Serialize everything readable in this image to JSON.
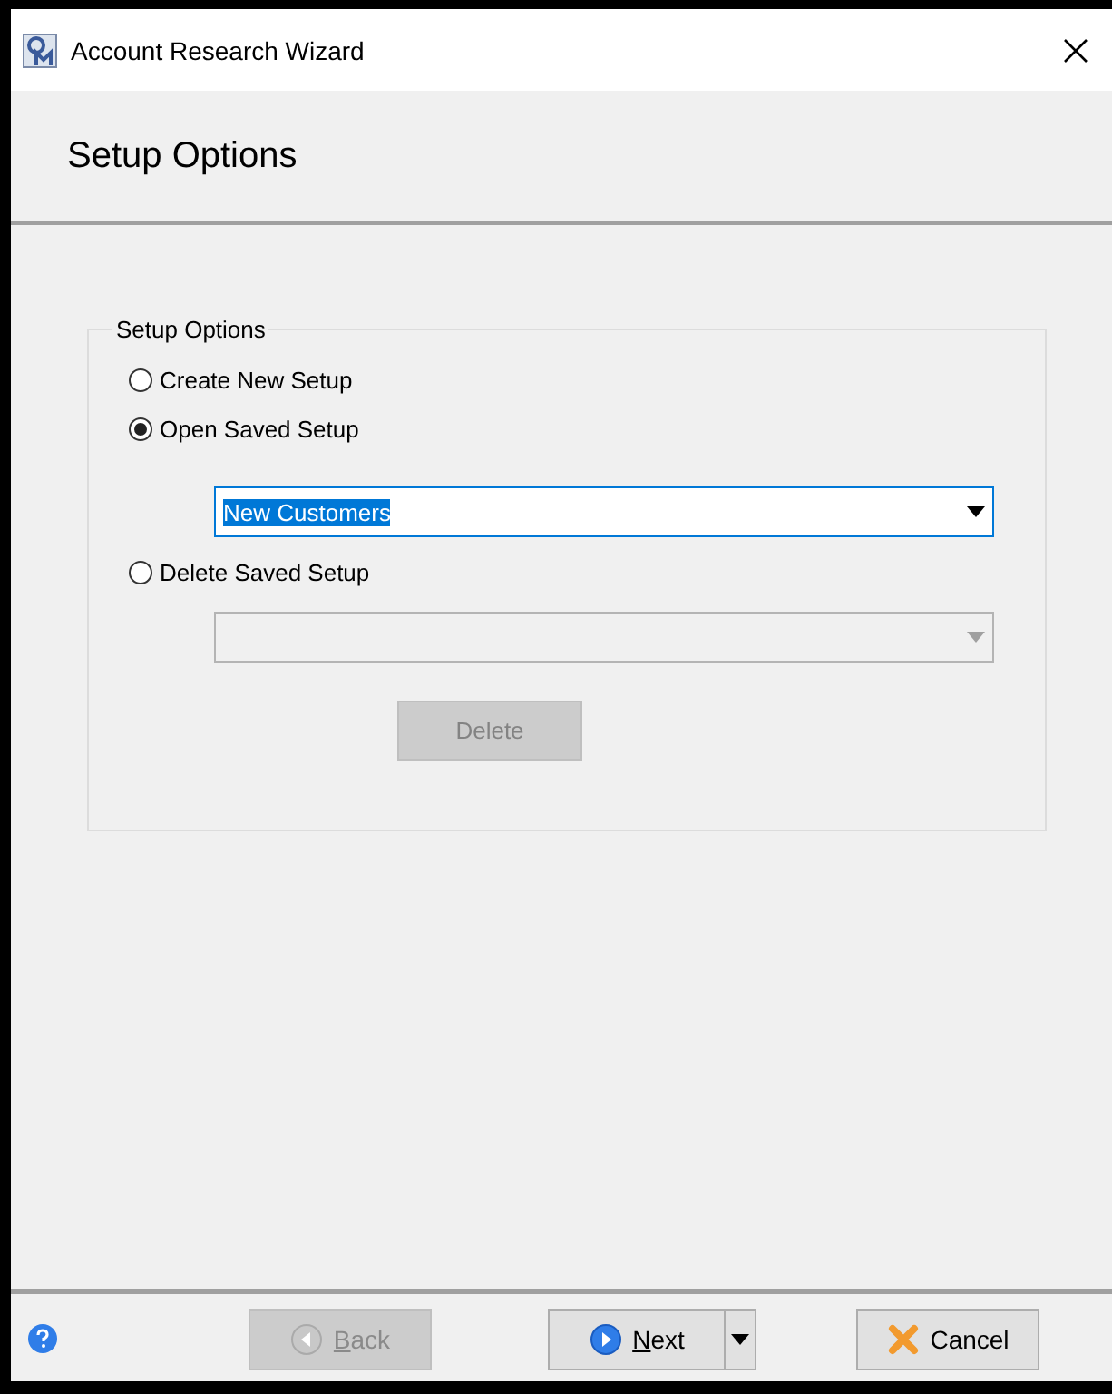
{
  "window": {
    "title": "Account Research Wizard"
  },
  "header": {
    "title": "Setup Options"
  },
  "group": {
    "legend": "Setup Options",
    "options": [
      {
        "label": "Create New Setup",
        "selected": false
      },
      {
        "label": "Open Saved Setup",
        "selected": true,
        "combo": {
          "value": "New Customers",
          "disabled": false,
          "text_selected": true
        }
      },
      {
        "label": "Delete Saved Setup",
        "selected": false,
        "combo": {
          "disabled": true
        },
        "button": {
          "label": "Delete",
          "disabled": true
        }
      }
    ]
  },
  "footer": {
    "buttons": [
      {
        "label": "Back",
        "kind": "back",
        "disabled": true,
        "mnemonic": true,
        "split": false
      },
      {
        "label": "Next",
        "kind": "next",
        "disabled": false,
        "mnemonic": true,
        "split": true
      },
      {
        "label": "Cancel",
        "kind": "cancel",
        "disabled": false,
        "mnemonic": false,
        "split": false
      }
    ]
  }
}
